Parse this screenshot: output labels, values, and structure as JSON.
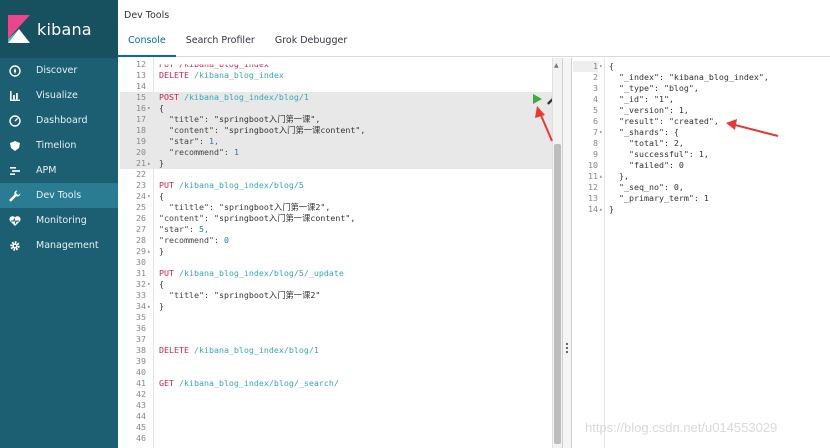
{
  "sidebar": {
    "logo_text": "kibana",
    "items": [
      {
        "label": "Discover",
        "icon": "compass-icon"
      },
      {
        "label": "Visualize",
        "icon": "bar-chart-icon"
      },
      {
        "label": "Dashboard",
        "icon": "dashboard-icon"
      },
      {
        "label": "Timelion",
        "icon": "shield-icon"
      },
      {
        "label": "APM",
        "icon": "apm-icon"
      },
      {
        "label": "Dev Tools",
        "icon": "wrench-icon",
        "active": true
      },
      {
        "label": "Monitoring",
        "icon": "heartbeat-icon"
      },
      {
        "label": "Management",
        "icon": "gear-icon"
      }
    ]
  },
  "header": {
    "title": "Dev Tools",
    "tabs": [
      {
        "label": "Console",
        "active": true
      },
      {
        "label": "Search Profiler"
      },
      {
        "label": "Grok Debugger"
      }
    ]
  },
  "editor": {
    "lines": [
      {
        "n": "12",
        "parts": [
          {
            "t": "PUT /kibana_blog_index",
            "c": "partial"
          }
        ]
      },
      {
        "n": "13",
        "parts": [
          {
            "t": "DELETE ",
            "c": "c-method"
          },
          {
            "t": "/kibana_blog_index",
            "c": "c-path"
          }
        ]
      },
      {
        "n": "14",
        "parts": []
      },
      {
        "n": "15",
        "hl": true,
        "parts": [
          {
            "t": "POST ",
            "c": "c-method"
          },
          {
            "t": "/kibana_blog_index/blog/1",
            "c": "c-path"
          }
        ]
      },
      {
        "n": "16",
        "fold": "▾",
        "hl": true,
        "parts": [
          {
            "t": "{",
            "c": "c-plain"
          }
        ]
      },
      {
        "n": "17",
        "hl": true,
        "parts": [
          {
            "t": "  \"title\": ",
            "c": "c-key"
          },
          {
            "t": "\"springboot入门第一课\",",
            "c": "c-str"
          }
        ]
      },
      {
        "n": "18",
        "hl": true,
        "parts": [
          {
            "t": "  \"content\": ",
            "c": "c-key"
          },
          {
            "t": "\"springboot入门第一课content\",",
            "c": "c-str"
          }
        ]
      },
      {
        "n": "19",
        "hl": true,
        "parts": [
          {
            "t": "  \"star\": ",
            "c": "c-key"
          },
          {
            "t": "1,",
            "c": "c-num"
          }
        ]
      },
      {
        "n": "20",
        "hl": true,
        "parts": [
          {
            "t": "  \"recommend\": ",
            "c": "c-key"
          },
          {
            "t": "1",
            "c": "c-num"
          }
        ]
      },
      {
        "n": "21",
        "fold": "▴",
        "hl": true,
        "parts": [
          {
            "t": "}",
            "c": "c-plain"
          }
        ]
      },
      {
        "n": "22",
        "parts": []
      },
      {
        "n": "23",
        "parts": [
          {
            "t": "PUT ",
            "c": "c-method"
          },
          {
            "t": "/kibana_blog_index/blog/5",
            "c": "c-path"
          }
        ]
      },
      {
        "n": "24",
        "fold": "▾",
        "parts": [
          {
            "t": "{",
            "c": "c-plain"
          }
        ]
      },
      {
        "n": "25",
        "parts": [
          {
            "t": "  \"tiltle\": ",
            "c": "c-key"
          },
          {
            "t": "\"springboot入门第一课2\",",
            "c": "c-str"
          }
        ]
      },
      {
        "n": "26",
        "parts": [
          {
            "t": "\"content\": ",
            "c": "c-key"
          },
          {
            "t": "\"springboot入门第一课content\",",
            "c": "c-str"
          }
        ]
      },
      {
        "n": "27",
        "parts": [
          {
            "t": "\"star\": ",
            "c": "c-key"
          },
          {
            "t": "5,",
            "c": "c-num"
          }
        ]
      },
      {
        "n": "28",
        "parts": [
          {
            "t": "\"recommend\": ",
            "c": "c-key"
          },
          {
            "t": "0",
            "c": "c-num"
          }
        ]
      },
      {
        "n": "29",
        "fold": "▴",
        "parts": [
          {
            "t": "}",
            "c": "c-plain"
          }
        ]
      },
      {
        "n": "30",
        "parts": []
      },
      {
        "n": "31",
        "parts": [
          {
            "t": "PUT ",
            "c": "c-method"
          },
          {
            "t": "/kibana_blog_index/blog/5/_update",
            "c": "c-path"
          }
        ]
      },
      {
        "n": "32",
        "fold": "▾",
        "parts": [
          {
            "t": "{",
            "c": "c-plain"
          }
        ]
      },
      {
        "n": "33",
        "parts": [
          {
            "t": "  \"title\": ",
            "c": "c-key"
          },
          {
            "t": "\"springboot入门第一课2\"",
            "c": "c-str"
          }
        ]
      },
      {
        "n": "34",
        "fold": "▴",
        "parts": [
          {
            "t": "}",
            "c": "c-plain"
          }
        ]
      },
      {
        "n": "35",
        "parts": []
      },
      {
        "n": "36",
        "parts": []
      },
      {
        "n": "37",
        "parts": []
      },
      {
        "n": "38",
        "parts": [
          {
            "t": "DELETE ",
            "c": "c-method"
          },
          {
            "t": "/kibana_blog_index/blog/1",
            "c": "c-path"
          }
        ]
      },
      {
        "n": "39",
        "parts": []
      },
      {
        "n": "40",
        "parts": []
      },
      {
        "n": "41",
        "parts": [
          {
            "t": "GET ",
            "c": "c-method"
          },
          {
            "t": "/kibana_blog_index/blog/_search/",
            "c": "c-path"
          }
        ]
      },
      {
        "n": "42",
        "parts": []
      },
      {
        "n": "43",
        "parts": []
      },
      {
        "n": "44",
        "parts": []
      },
      {
        "n": "45",
        "parts": []
      },
      {
        "n": "46",
        "parts": []
      }
    ]
  },
  "output": {
    "lines": [
      {
        "n": "1",
        "fold": "▾",
        "t": "{"
      },
      {
        "n": "2",
        "t": "  \"_index\": \"kibana_blog_index\","
      },
      {
        "n": "3",
        "t": "  \"_type\": \"blog\","
      },
      {
        "n": "4",
        "t": "  \"_id\": \"1\","
      },
      {
        "n": "5",
        "t": "  \"_version\": 1,"
      },
      {
        "n": "6",
        "t": "  \"result\": \"created\","
      },
      {
        "n": "7",
        "fold": "▾",
        "t": "  \"_shards\": {"
      },
      {
        "n": "8",
        "t": "    \"total\": 2,"
      },
      {
        "n": "9",
        "t": "    \"successful\": 1,"
      },
      {
        "n": "10",
        "t": "    \"failed\": 0"
      },
      {
        "n": "11",
        "fold": "▴",
        "t": "  },"
      },
      {
        "n": "12",
        "t": "  \"_seq_no\": 0,"
      },
      {
        "n": "13",
        "t": "  \"_primary_term\": 1"
      },
      {
        "n": "14",
        "fold": "▴",
        "t": "}"
      }
    ]
  },
  "watermark": "https://blog.csdn.net/u014553029",
  "colors": {
    "sidebar": "#1c5f73",
    "sidebar_active": "#2a7c93",
    "tab_active": "#006bb4",
    "method": "#c7254e",
    "path": "#3aa7b1",
    "run_button": "#3caa3c",
    "annotation_arrow": "#e53935"
  }
}
